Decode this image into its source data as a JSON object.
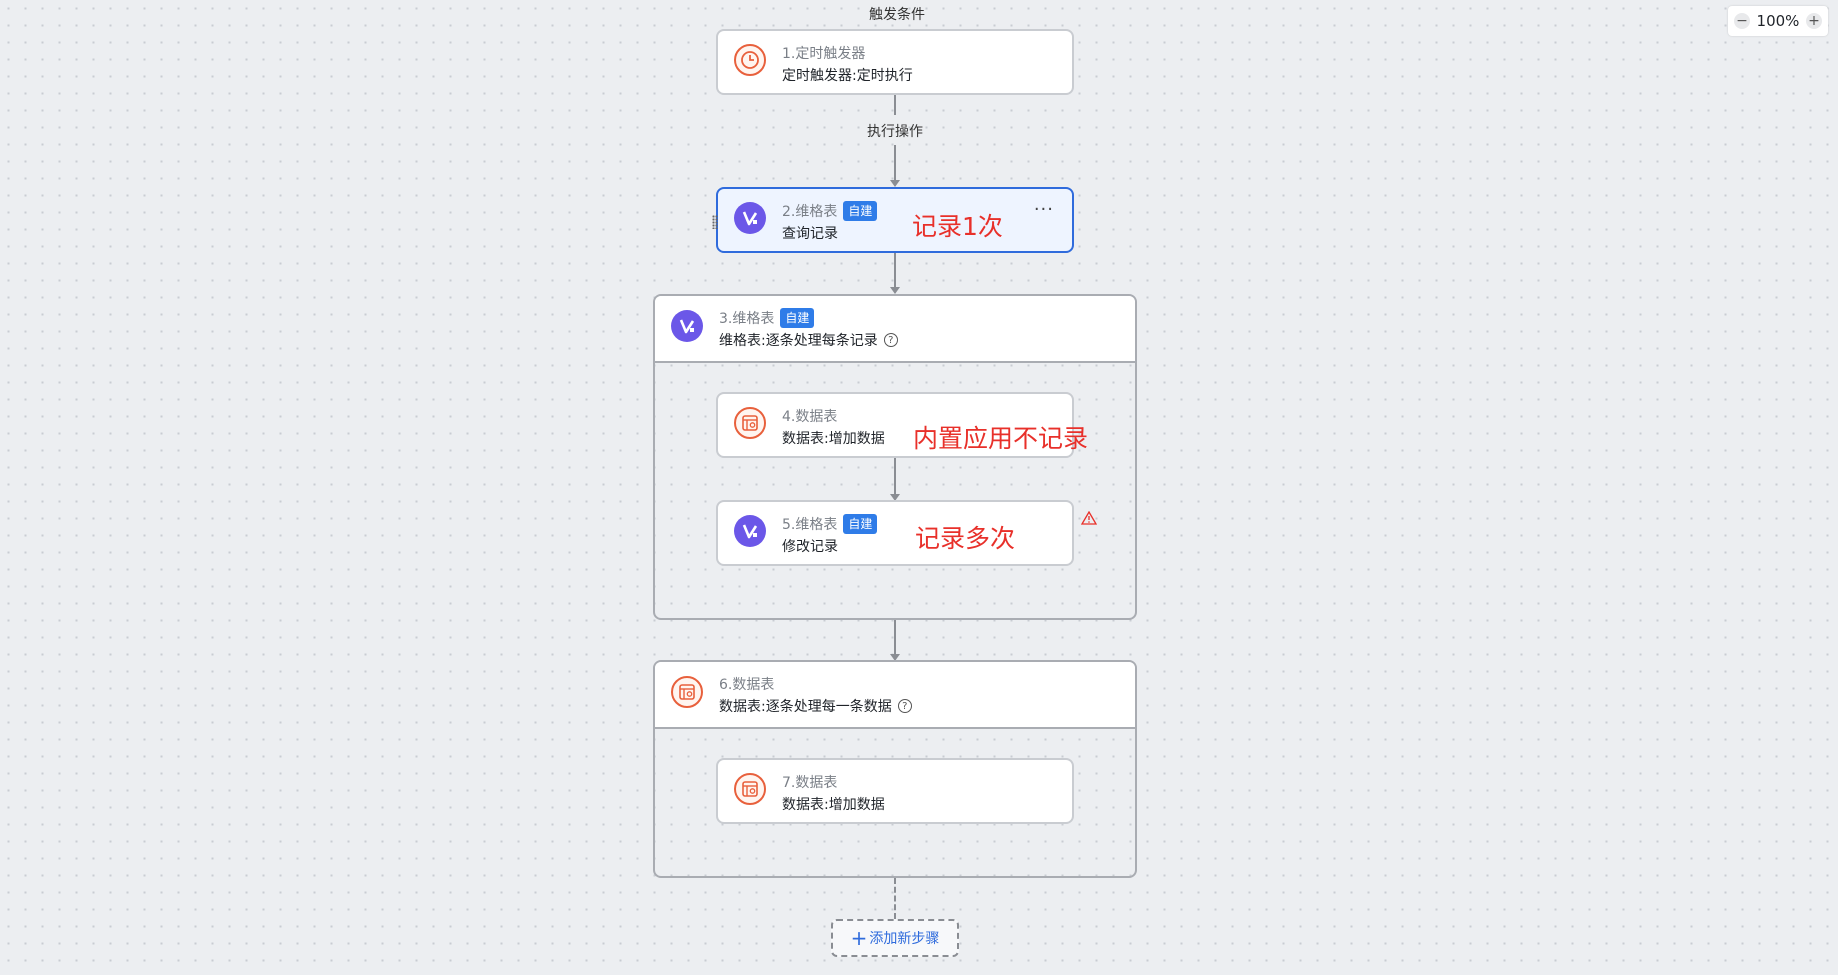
{
  "labels": {
    "trigger_section": "触发条件",
    "action_section": "执行操作"
  },
  "zoom": {
    "level": "100%",
    "minus": "−",
    "plus": "+"
  },
  "steps": [
    {
      "title": "1.定时触发器",
      "subtitle": "定时触发器:定时执行",
      "icon": "clock-icon"
    },
    {
      "title": "2.维格表",
      "badge": "自建",
      "subtitle": "查询记录",
      "icon": "vika-logo-icon",
      "more": "···"
    },
    {
      "title": "3.维格表",
      "badge": "自建",
      "subtitle": "维格表:逐条处理每条记录",
      "icon": "vika-logo-icon",
      "help": "?"
    },
    {
      "title": "4.数据表",
      "subtitle": "数据表:增加数据",
      "icon": "datasheet-icon"
    },
    {
      "title": "5.维格表",
      "badge": "自建",
      "subtitle": "修改记录",
      "icon": "vika-logo-icon"
    },
    {
      "title": "6.数据表",
      "subtitle": "数据表:逐条处理每一条数据",
      "icon": "datasheet-icon",
      "help": "?"
    },
    {
      "title": "7.数据表",
      "subtitle": "数据表:增加数据",
      "icon": "datasheet-icon"
    }
  ],
  "annotations": {
    "note1": "记录1次",
    "note2": "内置应用不记录",
    "note3": "记录多次"
  },
  "add_step": {
    "plus": "+",
    "label": "添加新步骤"
  },
  "colors": {
    "accent": "#2f6bdc",
    "badge": "#2f7ce8",
    "orange": "#e8603c",
    "purple": "#6b57e8",
    "note": "#e8302a"
  }
}
